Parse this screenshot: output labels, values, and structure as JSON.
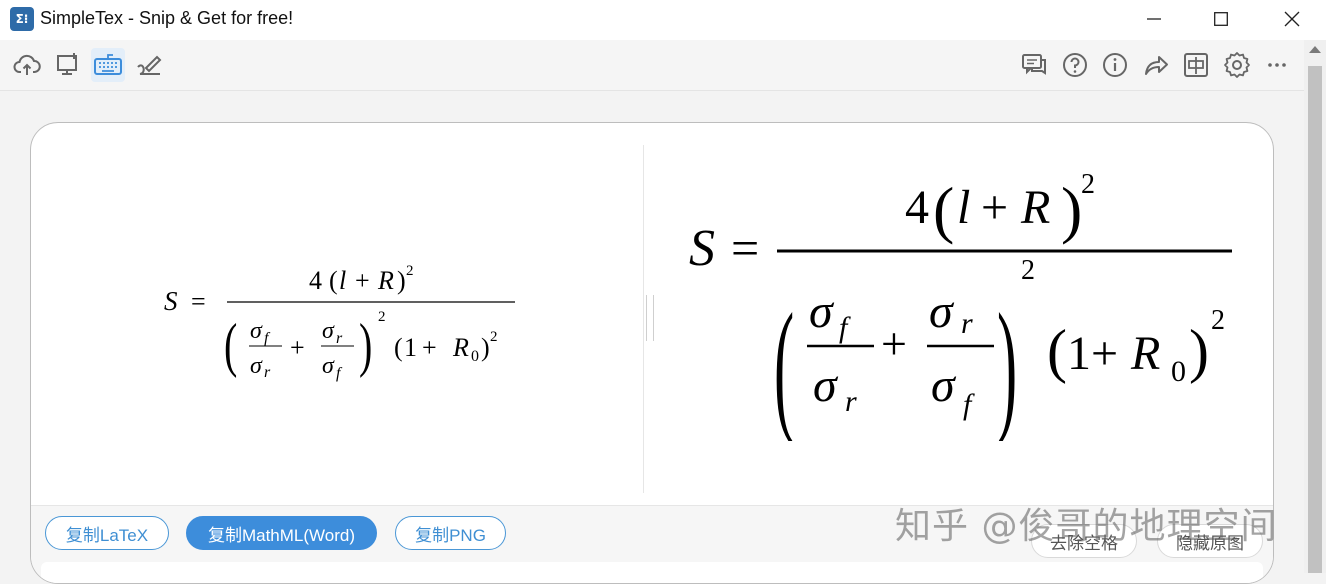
{
  "window": {
    "title": "SimpleTex - Snip & Get for free!",
    "logo_text": "Σ⁝"
  },
  "toolbar": {
    "left_icons": [
      "cloud-upload-icon",
      "screen-capture-icon",
      "keyboard-icon",
      "handwriting-icon"
    ],
    "active_icon": "keyboard-icon",
    "right_icons": [
      "feedback-icon",
      "help-icon",
      "info-icon",
      "share-icon",
      "chinese-toggle-icon",
      "settings-icon",
      "more-icon"
    ],
    "chinese_toggle_label": "中"
  },
  "formula": {
    "lhs": "S",
    "equals": "=",
    "coef": "4",
    "l": "l",
    "plus": "+",
    "R": "R",
    "sigma": "σ",
    "sub_f": "f",
    "sub_r": "r",
    "one": "1",
    "zero": "0",
    "exp": "2",
    "lparen": "(",
    "rparen": ")"
  },
  "buttons": {
    "copy_latex": "复制LaTeX",
    "copy_mathml": "复制MathML(Word)",
    "copy_png": "复制PNG",
    "remove_spaces": "去除空格",
    "hide_original": "隐藏原图"
  },
  "watermark": "知乎 @俊哥的地理空间",
  "colors": {
    "accent": "#3d8ddb",
    "logo": "#2e6ba8"
  }
}
